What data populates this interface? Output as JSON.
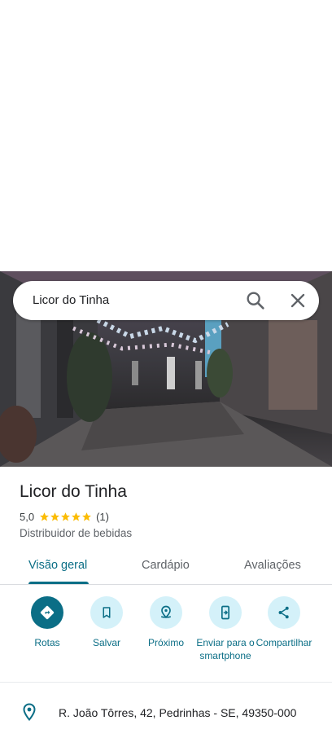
{
  "search": {
    "query": "Licor do Tinha",
    "search_icon": "search-icon",
    "clear_icon": "close-icon"
  },
  "place": {
    "name": "Licor do Tinha",
    "rating": "5,0",
    "stars": 5,
    "review_count": "(1)",
    "category": "Distribuidor de bebidas"
  },
  "tabs": [
    {
      "label": "Visão geral",
      "active": true
    },
    {
      "label": "Cardápio",
      "active": false
    },
    {
      "label": "Avaliações",
      "active": false
    }
  ],
  "actions": [
    {
      "label": "Rotas",
      "icon": "directions-icon"
    },
    {
      "label": "Salvar",
      "icon": "bookmark-icon"
    },
    {
      "label": "Próximo",
      "icon": "nearby-icon"
    },
    {
      "label": "Enviar para o smartphone",
      "icon": "send-to-phone-icon"
    },
    {
      "label": "Compartilhar",
      "icon": "share-icon"
    }
  ],
  "address": {
    "text": "R. João Tôrres, 42, Pedrinhas - SE, 49350-000",
    "icon": "location-pin-icon"
  },
  "colors": {
    "accent": "#0b6e86",
    "action_bg": "#d4f1f9",
    "star": "#fbbc04"
  }
}
